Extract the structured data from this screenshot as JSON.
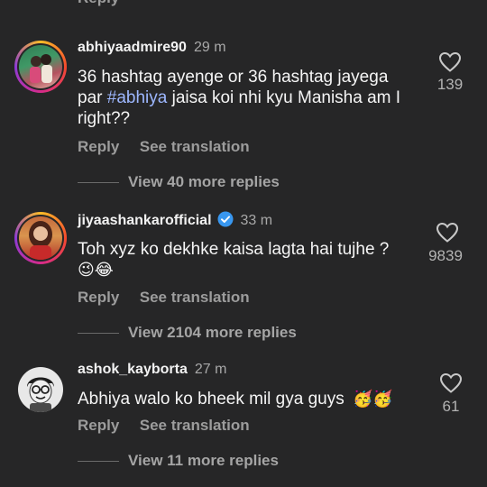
{
  "top_reply_label": "Reply",
  "comments": [
    {
      "username": "abhiyaadmire90",
      "time": "29 m",
      "text_lines": [
        "36 hashtag ayenge or 36 hashtag jayega",
        "par ",
        "#abhiya",
        " jaisa koi nhi kyu Manisha am I",
        "right??"
      ],
      "likes": "139",
      "reply_label": "Reply",
      "translate_label": "See translation",
      "view_more": "View 40 more replies"
    },
    {
      "username": "jiyaashankarofficial",
      "verified": true,
      "time": "33 m",
      "text": "Toh xyz ko dekhke kaisa lagta hai tujhe ?",
      "emojis": "😉😂",
      "likes": "9839",
      "reply_label": "Reply",
      "translate_label": "See translation",
      "view_more": "View 2104 more replies"
    },
    {
      "username": "ashok_kayborta",
      "time": "27 m",
      "text": "Abhiya walo ko bheek mil gya guys",
      "emojis": "🥳🥳",
      "likes": "61",
      "reply_label": "Reply",
      "translate_label": "See translation",
      "view_more": "View 11 more replies"
    }
  ],
  "colors": {
    "background": "#262627",
    "hashtag": "#9db7ff",
    "verified": "#3897f0"
  }
}
